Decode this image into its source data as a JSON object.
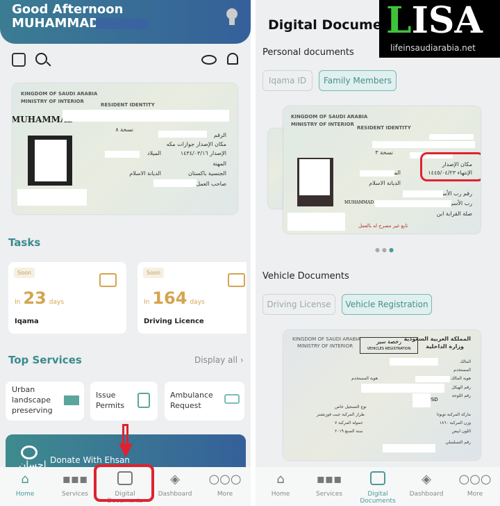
{
  "left": {
    "header": {
      "greeting": "Good Afternoon",
      "name": "MUHAMMAD"
    },
    "id_card": {
      "kingdom": "KINGDOM OF SAUDI ARABIA",
      "ministry": "MINISTRY OF INTERIOR",
      "resident_identity": "RESIDENT IDENTITY",
      "name_latin": "MUHAMMAD",
      "copy": "نسخة ٨",
      "issue_place": "مكان الإصدار جوازات مكه",
      "issue_date": "الإصدار ١٤٣٤/٠٣/١٦",
      "birth": "الميلاد",
      "profession": "المهنة",
      "religion": "الديانة الاسلام",
      "nationality": "الجنسية باكستان",
      "employer": "صاحب العمل",
      "number": "الرقم"
    },
    "tasks": {
      "title": "Tasks",
      "items": [
        {
          "badge": "Soon",
          "prefix": "In",
          "days": "23",
          "suffix": "days",
          "name": "Iqama"
        },
        {
          "badge": "Soon",
          "prefix": "In",
          "days": "164",
          "suffix": "days",
          "name": "Driving Licence"
        }
      ]
    },
    "services": {
      "title": "Top Services",
      "display_all": "Display all",
      "items": [
        {
          "label": "Urban landscape preserving",
          "icon": "building-icon"
        },
        {
          "label": "Issue Permits",
          "icon": "document-icon"
        },
        {
          "label": "Ambulance Request",
          "icon": "ambulance-icon"
        }
      ]
    },
    "donate": {
      "label": "Donate With Ehsan",
      "logo_text": "احسان"
    }
  },
  "right": {
    "title": "Digital Documents",
    "watermark": {
      "logo": "LISA",
      "url": "lifeinsaudiarabia.net"
    },
    "personal": {
      "title": "Personal documents",
      "tabs": [
        {
          "label": "Iqama ID",
          "active": false
        },
        {
          "label": "Family Members",
          "active": true
        }
      ]
    },
    "family_card": {
      "kingdom": "KINGDOM OF SAUDI ARABIA",
      "ministry": "MINISTRY OF INTERIOR",
      "resident_identity": "RESIDENT IDENTITY",
      "copy": "نسخة ٣",
      "issue_place": "مكان الإصدار",
      "expiry": "الإنتهاء ١٤٤٥/٠٤/٢٣",
      "birth": "الميلاد",
      "religion": "الديانة الاسلام",
      "family_head_no": "رقم رب الأسرة",
      "family_head": "رب الأسرة",
      "family_head_name": "MUHAMMAD",
      "relation": "صلة القرابة ابن",
      "footer": "تابع غير مصرح له بالعمل"
    },
    "vehicle": {
      "title": "Vehicle Documents",
      "tabs": [
        {
          "label": "Driving License",
          "active": false
        },
        {
          "label": "Vehicle Registration",
          "active": true
        }
      ]
    },
    "vehicle_card": {
      "kingdom": "KINGDOM OF SAUDI ARABIA",
      "ministry": "MINISTRY OF INTERIOR",
      "title_ar": "رخصة سير",
      "title_en": "VEHICLES REGISTRATION",
      "kingdom_ar": "المملكة العربية السعودية",
      "ministry_ar": "وزارة الداخلية",
      "owner": "المالك",
      "user": "المستخدم",
      "owner_id": "هوية المالك",
      "user_id": "هوية المستخدم",
      "chassis": "رقم الهيكل",
      "plate": "رقم اللوحة",
      "plate_val": "د س و USD",
      "reg_type": "نوع التسجيل خاص",
      "make": "ماركة المركبة تويوتا",
      "model": "طراز المركبة جيب فورتشنر",
      "weight": "وزن المركبة ١٨٦٠",
      "capacity": "حمولة المركبة ٧",
      "color": "اللون ابيض",
      "year": "سنة الصنع ٢٠١٩",
      "serial": "رقم التسلسلي"
    }
  },
  "nav": {
    "items": [
      {
        "label": "Home"
      },
      {
        "label": "Services"
      },
      {
        "label": "Digital Documents"
      },
      {
        "label": "Dashboard"
      },
      {
        "label": "More"
      }
    ]
  },
  "colors": {
    "accent": "#3c8a8f",
    "gold": "#d4a450",
    "header": "#35609a",
    "highlight": "#e0222e"
  }
}
